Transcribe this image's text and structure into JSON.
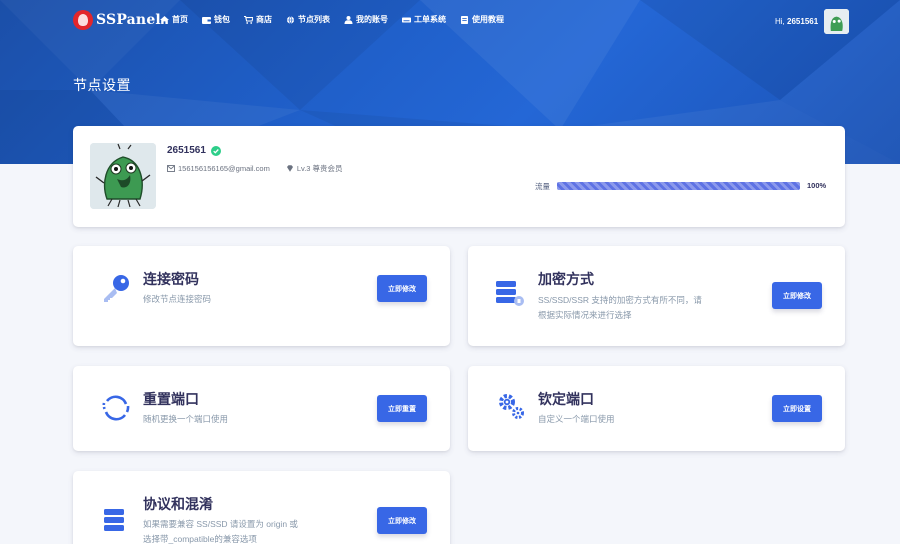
{
  "brand": {
    "name": "SSPanel"
  },
  "nav": {
    "items": [
      {
        "label": "首页",
        "icon": "home-icon"
      },
      {
        "label": "钱包",
        "icon": "wallet-icon"
      },
      {
        "label": "商店",
        "icon": "cart-icon"
      },
      {
        "label": "节点列表",
        "icon": "globe-icon"
      },
      {
        "label": "我的账号",
        "icon": "user-icon"
      },
      {
        "label": "工单系统",
        "icon": "keyboard-icon"
      },
      {
        "label": "使用教程",
        "icon": "book-icon"
      }
    ],
    "greeting": "Hi,",
    "username": "2651561"
  },
  "page": {
    "title": "节点设置"
  },
  "profile": {
    "name": "2651561",
    "email": "156156156165@gmail.com",
    "level": "Lv.3 尊贵会员",
    "traffic_label": "流量",
    "traffic_percent": 100,
    "traffic_percent_text": "100%"
  },
  "cards": [
    {
      "title": "连接密码",
      "desc": [
        "修改节点连接密码"
      ],
      "button": "立即修改",
      "icon": "key-icon"
    },
    {
      "title": "加密方式",
      "desc": [
        "SS/SSD/SSR 支持的加密方式有所不同，请",
        "根据实际情况来进行选择"
      ],
      "button": "立即修改",
      "icon": "server-icon"
    },
    {
      "title": "重置端口",
      "desc": [
        "随机更换一个端口使用"
      ],
      "button": "立即重置",
      "icon": "refresh-icon"
    },
    {
      "title": "钦定端口",
      "desc": [
        "自定义一个端口使用"
      ],
      "button": "立即设置",
      "icon": "gears-icon"
    },
    {
      "title": "协议和混淆",
      "desc": [
        "如果需要兼容 SS/SSD 请设置为 origin 或",
        "选择带_compatible的兼容选项"
      ],
      "button": "立即修改",
      "icon": "server-icon"
    }
  ],
  "colors": {
    "primary": "#3867e6",
    "hero": "#1f5ec7",
    "success": "#2dce89",
    "progress": "#5e72e4"
  }
}
